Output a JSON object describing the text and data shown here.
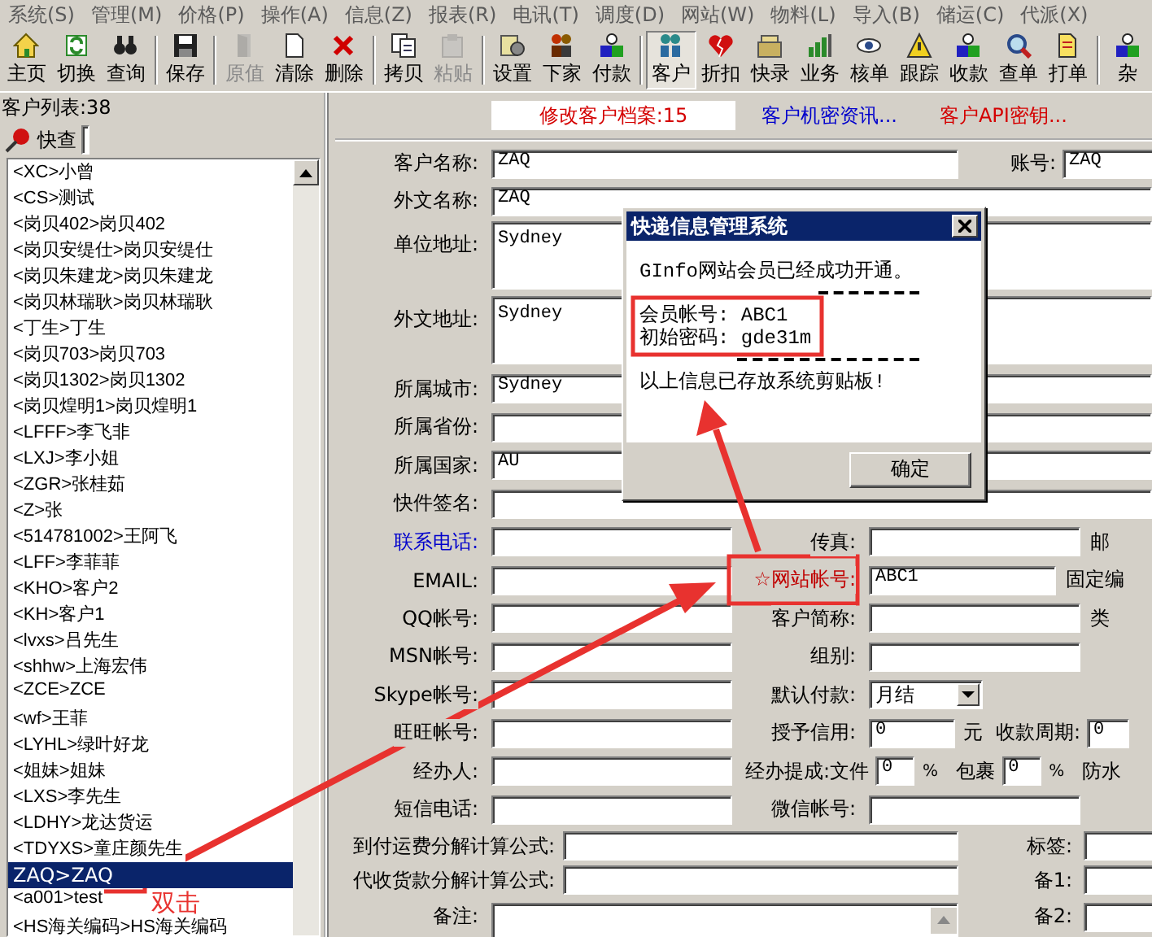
{
  "menu": [
    "系统(S)",
    "管理(M)",
    "价格(P)",
    "操作(A)",
    "信息(Z)",
    "报表(R)",
    "电讯(T)",
    "调度(D)",
    "网站(W)",
    "物料(L)",
    "导入(B)",
    "储运(C)",
    "代派(X)"
  ],
  "toolbar": [
    [
      {
        "label": "主页",
        "disabled": false,
        "pressed": false
      },
      {
        "label": "切换",
        "disabled": false,
        "pressed": false
      },
      {
        "label": "查询",
        "disabled": false,
        "pressed": false
      }
    ],
    [
      {
        "label": "保存",
        "disabled": false,
        "pressed": false
      }
    ],
    [
      {
        "label": "原值",
        "disabled": true,
        "pressed": false
      },
      {
        "label": "清除",
        "disabled": false,
        "pressed": false
      },
      {
        "label": "删除",
        "disabled": false,
        "pressed": false
      }
    ],
    [
      {
        "label": "拷贝",
        "disabled": false,
        "pressed": false
      },
      {
        "label": "粘贴",
        "disabled": true,
        "pressed": false
      }
    ],
    [
      {
        "label": "设置",
        "disabled": false,
        "pressed": false
      },
      {
        "label": "下家",
        "disabled": false,
        "pressed": false
      },
      {
        "label": "付款",
        "disabled": false,
        "pressed": false
      }
    ],
    [
      {
        "label": "客户",
        "disabled": false,
        "pressed": true
      },
      {
        "label": "折扣",
        "disabled": false,
        "pressed": false
      },
      {
        "label": "快录",
        "disabled": false,
        "pressed": false
      },
      {
        "label": "业务",
        "disabled": false,
        "pressed": false
      },
      {
        "label": "核单",
        "disabled": false,
        "pressed": false
      },
      {
        "label": "跟踪",
        "disabled": false,
        "pressed": false
      },
      {
        "label": "收款",
        "disabled": false,
        "pressed": false
      },
      {
        "label": "查单",
        "disabled": false,
        "pressed": false
      },
      {
        "label": "打单",
        "disabled": false,
        "pressed": false
      }
    ],
    [
      {
        "label": "杂",
        "disabled": false,
        "pressed": false
      }
    ]
  ],
  "customer_list": {
    "title": "客户列表:38",
    "search_label": "快查",
    "items": [
      {
        "label": "<XC>小曾",
        "selected": false
      },
      {
        "label": "<CS>测试",
        "selected": false
      },
      {
        "label": "<岗贝402>岗贝402",
        "selected": false
      },
      {
        "label": "<岗贝安缇仕>岗贝安缇仕",
        "selected": false
      },
      {
        "label": "<岗贝朱建龙>岗贝朱建龙",
        "selected": false
      },
      {
        "label": "<岗贝林瑞耿>岗贝林瑞耿",
        "selected": false
      },
      {
        "label": "<丁生>丁生",
        "selected": false
      },
      {
        "label": "<岗贝703>岗贝703",
        "selected": false
      },
      {
        "label": "<岗贝1302>岗贝1302",
        "selected": false
      },
      {
        "label": "<岗贝煌明1>岗贝煌明1",
        "selected": false
      },
      {
        "label": "<LFFF>李飞非",
        "selected": false
      },
      {
        "label": "<LXJ>李小姐",
        "selected": false
      },
      {
        "label": "<ZGR>张桂茹",
        "selected": false
      },
      {
        "label": "<Z>张",
        "selected": false
      },
      {
        "label": "<514781002>王阿飞",
        "selected": false
      },
      {
        "label": "<LFF>李菲菲",
        "selected": false
      },
      {
        "label": "<KHO>客户2",
        "selected": false
      },
      {
        "label": "<KH>客户1",
        "selected": false
      },
      {
        "label": "<lvxs>吕先生",
        "selected": false
      },
      {
        "label": "<shhw>上海宏伟",
        "selected": false
      },
      {
        "label": "<ZCE>ZCE",
        "selected": false
      },
      {
        "label": "<wf>王菲",
        "selected": false
      },
      {
        "label": "<LYHL>绿叶好龙",
        "selected": false
      },
      {
        "label": "<姐妹>姐妹",
        "selected": false
      },
      {
        "label": "<LXS>李先生",
        "selected": false
      },
      {
        "label": "<LDHY>龙达货运",
        "selected": false
      },
      {
        "label": "<TDYXS>童庄颜先生",
        "selected": false
      },
      {
        "label": "ZAQ>ZAQ",
        "selected": true
      },
      {
        "label": "<a001>test",
        "selected": false
      },
      {
        "label": "<HS海关编码>HS海关编码",
        "selected": false
      }
    ]
  },
  "header_tabs": [
    {
      "label": "修改客户档案:15",
      "color": "#d40000",
      "selected": true
    },
    {
      "label": "客户机密资讯...",
      "color": "#0000cc",
      "selected": false
    },
    {
      "label": "客户API密钥...",
      "color": "#d40000",
      "selected": false
    }
  ],
  "form": {
    "rows": [
      {
        "kind": "name",
        "label": "客户名称:",
        "value": "ZAQ",
        "side_label": "账号:",
        "side_value": "ZAQ"
      },
      {
        "kind": "wide",
        "label": "外文名称:",
        "value": "ZAQ"
      },
      {
        "kind": "area",
        "label": "单位地址:",
        "value": "Sydney"
      },
      {
        "kind": "area",
        "label": "外文地址:",
        "value": "Sydney"
      },
      {
        "kind": "wide",
        "label": "所属城市:",
        "value": "Sydney"
      },
      {
        "kind": "wide",
        "label": "所属省份:"
      },
      {
        "kind": "wide",
        "label": "所属国家:",
        "value": "AU"
      },
      {
        "kind": "wide",
        "label": "快件签名:"
      },
      {
        "kind": "split",
        "label": "联系电话:",
        "color": "#0000cc",
        "right": {
          "kind": "field",
          "label": "传真:"
        },
        "edge_label": "邮"
      },
      {
        "kind": "split",
        "label": "EMAIL:",
        "right": {
          "kind": "short",
          "label": "☆网站帐号:",
          "color": "#c00000",
          "value": "ABC1"
        },
        "edge_label": "固定编"
      },
      {
        "kind": "split",
        "label": "QQ帐号:",
        "right": {
          "kind": "field",
          "label": "客户简称:"
        },
        "edge_label": "类"
      },
      {
        "kind": "split",
        "label": "MSN帐号:",
        "right": {
          "kind": "field",
          "label": "组别:"
        }
      },
      {
        "kind": "split",
        "label": "Skype帐号:",
        "right": {
          "kind": "select",
          "label": "默认付款:",
          "value": "月结"
        }
      },
      {
        "kind": "split",
        "label": "旺旺帐号:",
        "right": {
          "kind": "credit",
          "label": "授予信用:",
          "value": "0",
          "unit": "元",
          "label2": "收款周期:",
          "value2": "0"
        }
      },
      {
        "kind": "split",
        "label": "经办人:",
        "right": {
          "kind": "commission",
          "label": "经办提成:文件",
          "value": "0",
          "unit": "%",
          "label2": "包裹",
          "value2": "0",
          "unit2": "%"
        },
        "edge_label": "防水"
      },
      {
        "kind": "split",
        "label": "短信电话:",
        "right": {
          "kind": "field",
          "label": "微信帐号:"
        }
      },
      {
        "kind": "formula",
        "label": "到付运费分解计算公式:",
        "side_label": "标签:"
      },
      {
        "kind": "formula",
        "label": "代收货款分解计算公式:",
        "side_label": "备1:"
      },
      {
        "kind": "remark",
        "label": "备注:",
        "side_label": "备2:"
      }
    ]
  },
  "dialog": {
    "title": "快递信息管理系统",
    "lines": [
      {
        "kind": "text",
        "text": "GInfo网站会员已经成功开通。"
      },
      {
        "kind": "rule"
      },
      {
        "kind": "text",
        "text": "会员帐号: ABC1"
      },
      {
        "kind": "text",
        "text": "初始密码: gde31m"
      },
      {
        "kind": "rule"
      },
      {
        "kind": "text",
        "text": "以上信息已存放系统剪贴板!"
      }
    ],
    "button": "确定"
  },
  "annotation": {
    "note": "双击"
  }
}
